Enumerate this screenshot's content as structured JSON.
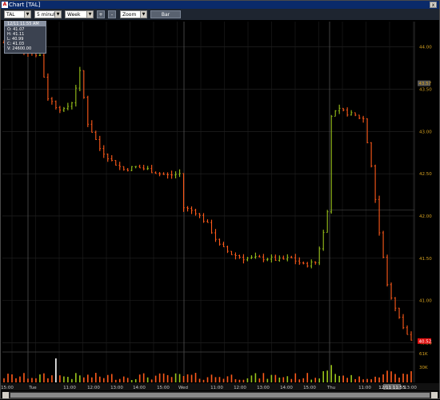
{
  "window": {
    "title": "Chart [TAL]",
    "close_label": "x"
  },
  "toolbar": {
    "symbol": "TAL",
    "interval": "5 minutes",
    "range": "Week",
    "plus_label": "+",
    "minus_label": "-",
    "zoom": "Zoom",
    "style_label": "Bar"
  },
  "info": {
    "header": "12/11 11:55 AM",
    "open": "O: 41.07",
    "high": "H: 41.11",
    "low": "L: 40.99",
    "close": "C: 41.03",
    "volume": "V: 24600.00"
  },
  "axis": {
    "price_labels": [
      "44.00",
      "43.50",
      "43.00",
      "42.50",
      "42.00",
      "41.50",
      "41.00",
      "40.50"
    ],
    "price_markers": {
      "upper": "43.57",
      "last": "40.52"
    },
    "volume_labels": [
      "61K",
      "30K"
    ],
    "time_labels": [
      "15:00",
      "Tue",
      "11:00",
      "12:00",
      "13:00",
      "14:00",
      "15:00",
      "Wed",
      "11:00",
      "12:00",
      "13:00",
      "14:00",
      "15:00",
      "Thu",
      "11:00",
      "12:00",
      "13:00"
    ],
    "time_marker": "12/11 11:55"
  },
  "chart_data": {
    "type": "bar",
    "symbol": "TAL",
    "interval": "5 minutes",
    "ylim": [
      40.4,
      44.3
    ],
    "series_anchors": [
      [
        0,
        44.05
      ],
      [
        3,
        44.0
      ],
      [
        6,
        43.95
      ],
      [
        9,
        43.9
      ],
      [
        11,
        43.4
      ],
      [
        13,
        43.3
      ],
      [
        15,
        43.25
      ],
      [
        17,
        43.35
      ],
      [
        19,
        43.7
      ],
      [
        21,
        43.1
      ],
      [
        24,
        42.8
      ],
      [
        27,
        42.65
      ],
      [
        30,
        42.55
      ],
      [
        33,
        42.58
      ],
      [
        36,
        42.55
      ],
      [
        39,
        42.5
      ],
      [
        41,
        42.48
      ],
      [
        44,
        42.5
      ],
      [
        45,
        42.1
      ],
      [
        48,
        42.05
      ],
      [
        51,
        41.9
      ],
      [
        54,
        41.65
      ],
      [
        57,
        41.55
      ],
      [
        60,
        41.5
      ],
      [
        63,
        41.5
      ],
      [
        66,
        41.5
      ],
      [
        69,
        41.48
      ],
      [
        72,
        41.5
      ],
      [
        75,
        41.42
      ],
      [
        78,
        41.45
      ],
      [
        80,
        41.8
      ],
      [
        81,
        42.05
      ],
      [
        82,
        43.2
      ],
      [
        84,
        43.25
      ],
      [
        87,
        43.2
      ],
      [
        90,
        43.15
      ],
      [
        92,
        42.6
      ],
      [
        94,
        41.8
      ],
      [
        96,
        41.2
      ],
      [
        98,
        40.9
      ],
      [
        100,
        40.68
      ],
      [
        102,
        40.52
      ]
    ],
    "volume_max_k": 61
  }
}
